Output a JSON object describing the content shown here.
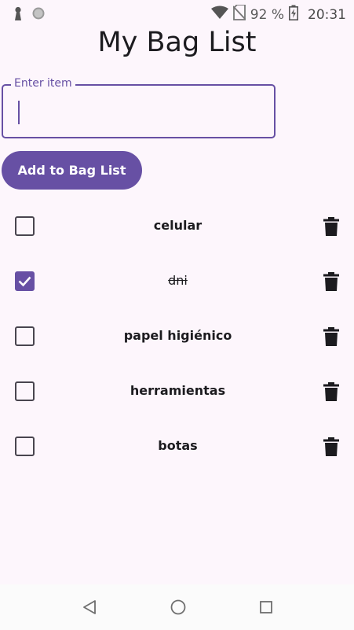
{
  "status_bar": {
    "battery_percent": "92 %",
    "time": "20:31",
    "icons": [
      "notification-icon",
      "sync-icon",
      "wifi-icon",
      "no-sim-icon",
      "battery-charging-icon"
    ]
  },
  "app": {
    "title": "My Bag List"
  },
  "input": {
    "label": "Enter item",
    "value": ""
  },
  "add_button": {
    "label": "Add to Bag List"
  },
  "items": [
    {
      "label": "celular",
      "checked": false
    },
    {
      "label": "dni",
      "checked": true
    },
    {
      "label": "papel higiénico",
      "checked": false
    },
    {
      "label": "herramientas",
      "checked": false
    },
    {
      "label": "botas",
      "checked": false
    }
  ],
  "colors": {
    "accent": "#6750a4",
    "background": "#fdf6fc",
    "text": "#1c1b1f"
  },
  "nav_bar": {
    "buttons": [
      "back-icon",
      "home-icon",
      "recents-icon"
    ]
  }
}
